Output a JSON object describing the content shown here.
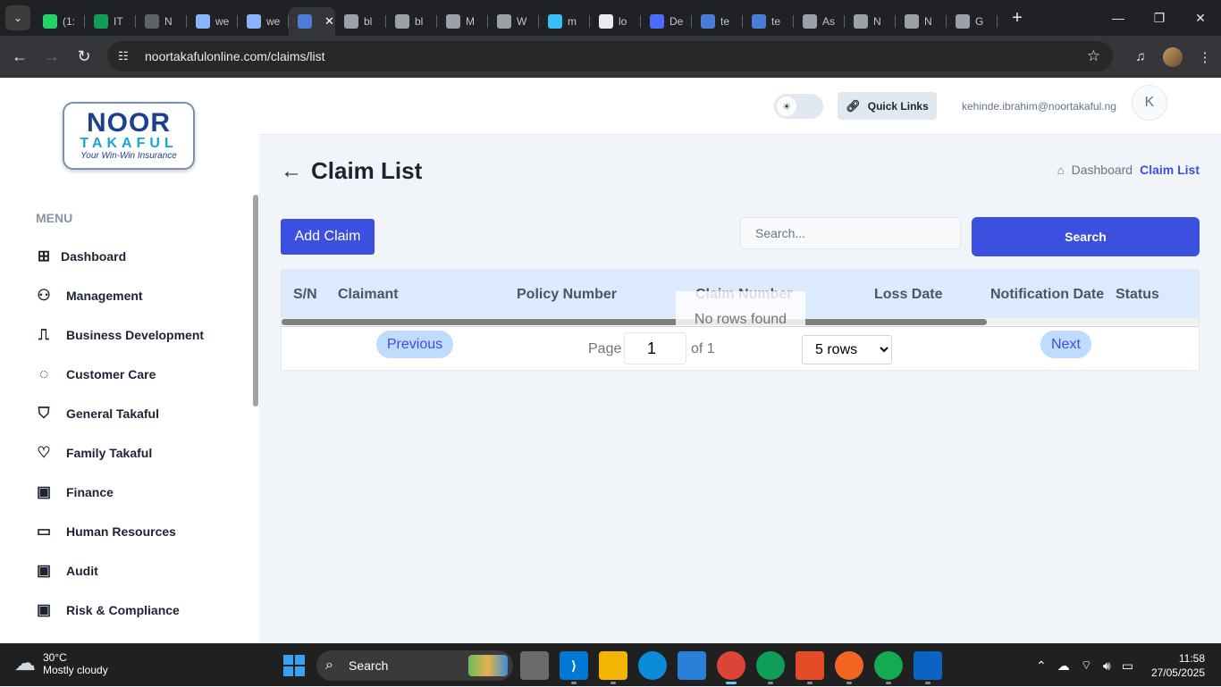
{
  "browser": {
    "tabs": [
      {
        "title": "(1:",
        "icon": "whatsapp-icon",
        "color": "#25d366"
      },
      {
        "title": "IT",
        "icon": "sheets-icon",
        "color": "#0f9d58"
      },
      {
        "title": "N",
        "icon": "news-icon",
        "color": "#5f6368"
      },
      {
        "title": "we",
        "icon": "doc-icon",
        "color": "#8ab4f8"
      },
      {
        "title": "we",
        "icon": "doc-icon",
        "color": "#8ab4f8"
      },
      {
        "title": "",
        "icon": "noor-icon",
        "color": "#4a7dd8",
        "active": true
      },
      {
        "title": "bl",
        "icon": "globe-icon",
        "color": "#9aa0a6"
      },
      {
        "title": "bl",
        "icon": "globe-icon",
        "color": "#9aa0a6"
      },
      {
        "title": "M",
        "icon": "openai-icon",
        "color": "#9aa0a6"
      },
      {
        "title": "W",
        "icon": "globe-icon",
        "color": "#9aa0a6"
      },
      {
        "title": "m",
        "icon": "tailwind-icon",
        "color": "#38bdf8"
      },
      {
        "title": "lo",
        "icon": "vercel-icon",
        "color": "#e8eaed"
      },
      {
        "title": "De",
        "icon": "deepseek-icon",
        "color": "#4d6bfe"
      },
      {
        "title": "te",
        "icon": "noor-icon",
        "color": "#4a7dd8"
      },
      {
        "title": "te",
        "icon": "noor-icon",
        "color": "#4a7dd8"
      },
      {
        "title": "As",
        "icon": "globe-icon",
        "color": "#9aa0a6"
      },
      {
        "title": "N",
        "icon": "chrome-icon",
        "color": "#9aa0a6"
      },
      {
        "title": "N",
        "icon": "chrome-icon",
        "color": "#9aa0a6"
      },
      {
        "title": "G",
        "icon": "openai-icon",
        "color": "#9aa0a6"
      }
    ],
    "tab_close": "✕",
    "new_tab": "+",
    "url": "noortakafulonline.com/claims/list"
  },
  "logo": {
    "line1": "NOOR",
    "line2": "TAKAFUL",
    "tagline": "Your Win-Win Insurance"
  },
  "sidebar": {
    "heading": "MENU",
    "items": [
      {
        "label": "Dashboard",
        "icon": "grid-icon"
      },
      {
        "label": "Management",
        "icon": "user-group-icon"
      },
      {
        "label": "Business Development",
        "icon": "flow-icon"
      },
      {
        "label": "Customer Care",
        "icon": "chat-icon"
      },
      {
        "label": "General Takaful",
        "icon": "shield-icon"
      },
      {
        "label": "Family Takaful",
        "icon": "heart-icon"
      },
      {
        "label": "Finance",
        "icon": "money-icon"
      },
      {
        "label": "Human Resources",
        "icon": "message-icon"
      },
      {
        "label": "Audit",
        "icon": "money-icon"
      },
      {
        "label": "Risk & Compliance",
        "icon": "money-icon"
      }
    ]
  },
  "header": {
    "quick_links": "Quick Links",
    "email": "kehinde.ibrahim@noortakaful.ng",
    "avatar_initial": "K"
  },
  "page": {
    "title": "Claim List",
    "breadcrumb": [
      "Dashboard",
      "Claim List"
    ],
    "add_button": "Add Claim",
    "search_placeholder": "Search...",
    "search_button": "Search",
    "columns": [
      "S/N",
      "Claimant",
      "Policy Number",
      "Claim Number",
      "Loss Date",
      "Notification Date",
      "Status"
    ],
    "empty_message": "No rows found",
    "pagination": {
      "previous": "Previous",
      "next": "Next",
      "page_label": "Page",
      "current_page": "1",
      "of_label": "of 1",
      "rows_option": "5 rows"
    }
  },
  "taskbar": {
    "weather_temp": "30°C",
    "weather_desc": "Mostly cloudy",
    "search_label": "Search",
    "time": "11:58",
    "date": "27/05/2025"
  },
  "colors": {
    "primary": "#3c50e0",
    "header_row": "#dbeafe",
    "pager_button": "#bfdbfe"
  }
}
